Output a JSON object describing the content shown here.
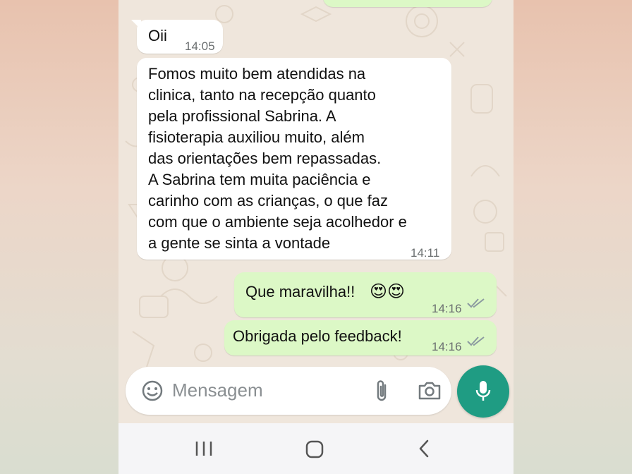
{
  "colors": {
    "incoming_bubble": "#ffffff",
    "outgoing_bubble": "#dcf8c6",
    "accent": "#1f9c83",
    "read_ticks": "#8c9aa0"
  },
  "messages": [
    {
      "direction": "incoming",
      "text": "Oii",
      "time": "14:05"
    },
    {
      "direction": "incoming",
      "text": "Fomos muito bem atendidas na\nclinica, tanto na recepção quanto\npela profissional Sabrina. A\nfisioterapia auxiliou muito, além\ndas orientações bem repassadas.\nA Sabrina tem muita paciência e\ncarinho com as crianças, o que faz\ncom que o ambiente seja acolhedor e\na gente se sinta a vontade",
      "time": "14:11"
    },
    {
      "direction": "outgoing",
      "text": "Que maravilha!!",
      "emoji": "😍😍",
      "time": "14:16",
      "status": "read"
    },
    {
      "direction": "outgoing",
      "text": "Obrigada pelo feedback!",
      "time": "14:16",
      "status": "read"
    }
  ],
  "composer": {
    "placeholder": "Mensagem",
    "icons": [
      "emoji-icon",
      "attach-icon",
      "camera-icon",
      "mic-icon"
    ]
  },
  "navbar": {
    "icons": [
      "recent-apps-icon",
      "home-icon",
      "back-icon"
    ]
  }
}
